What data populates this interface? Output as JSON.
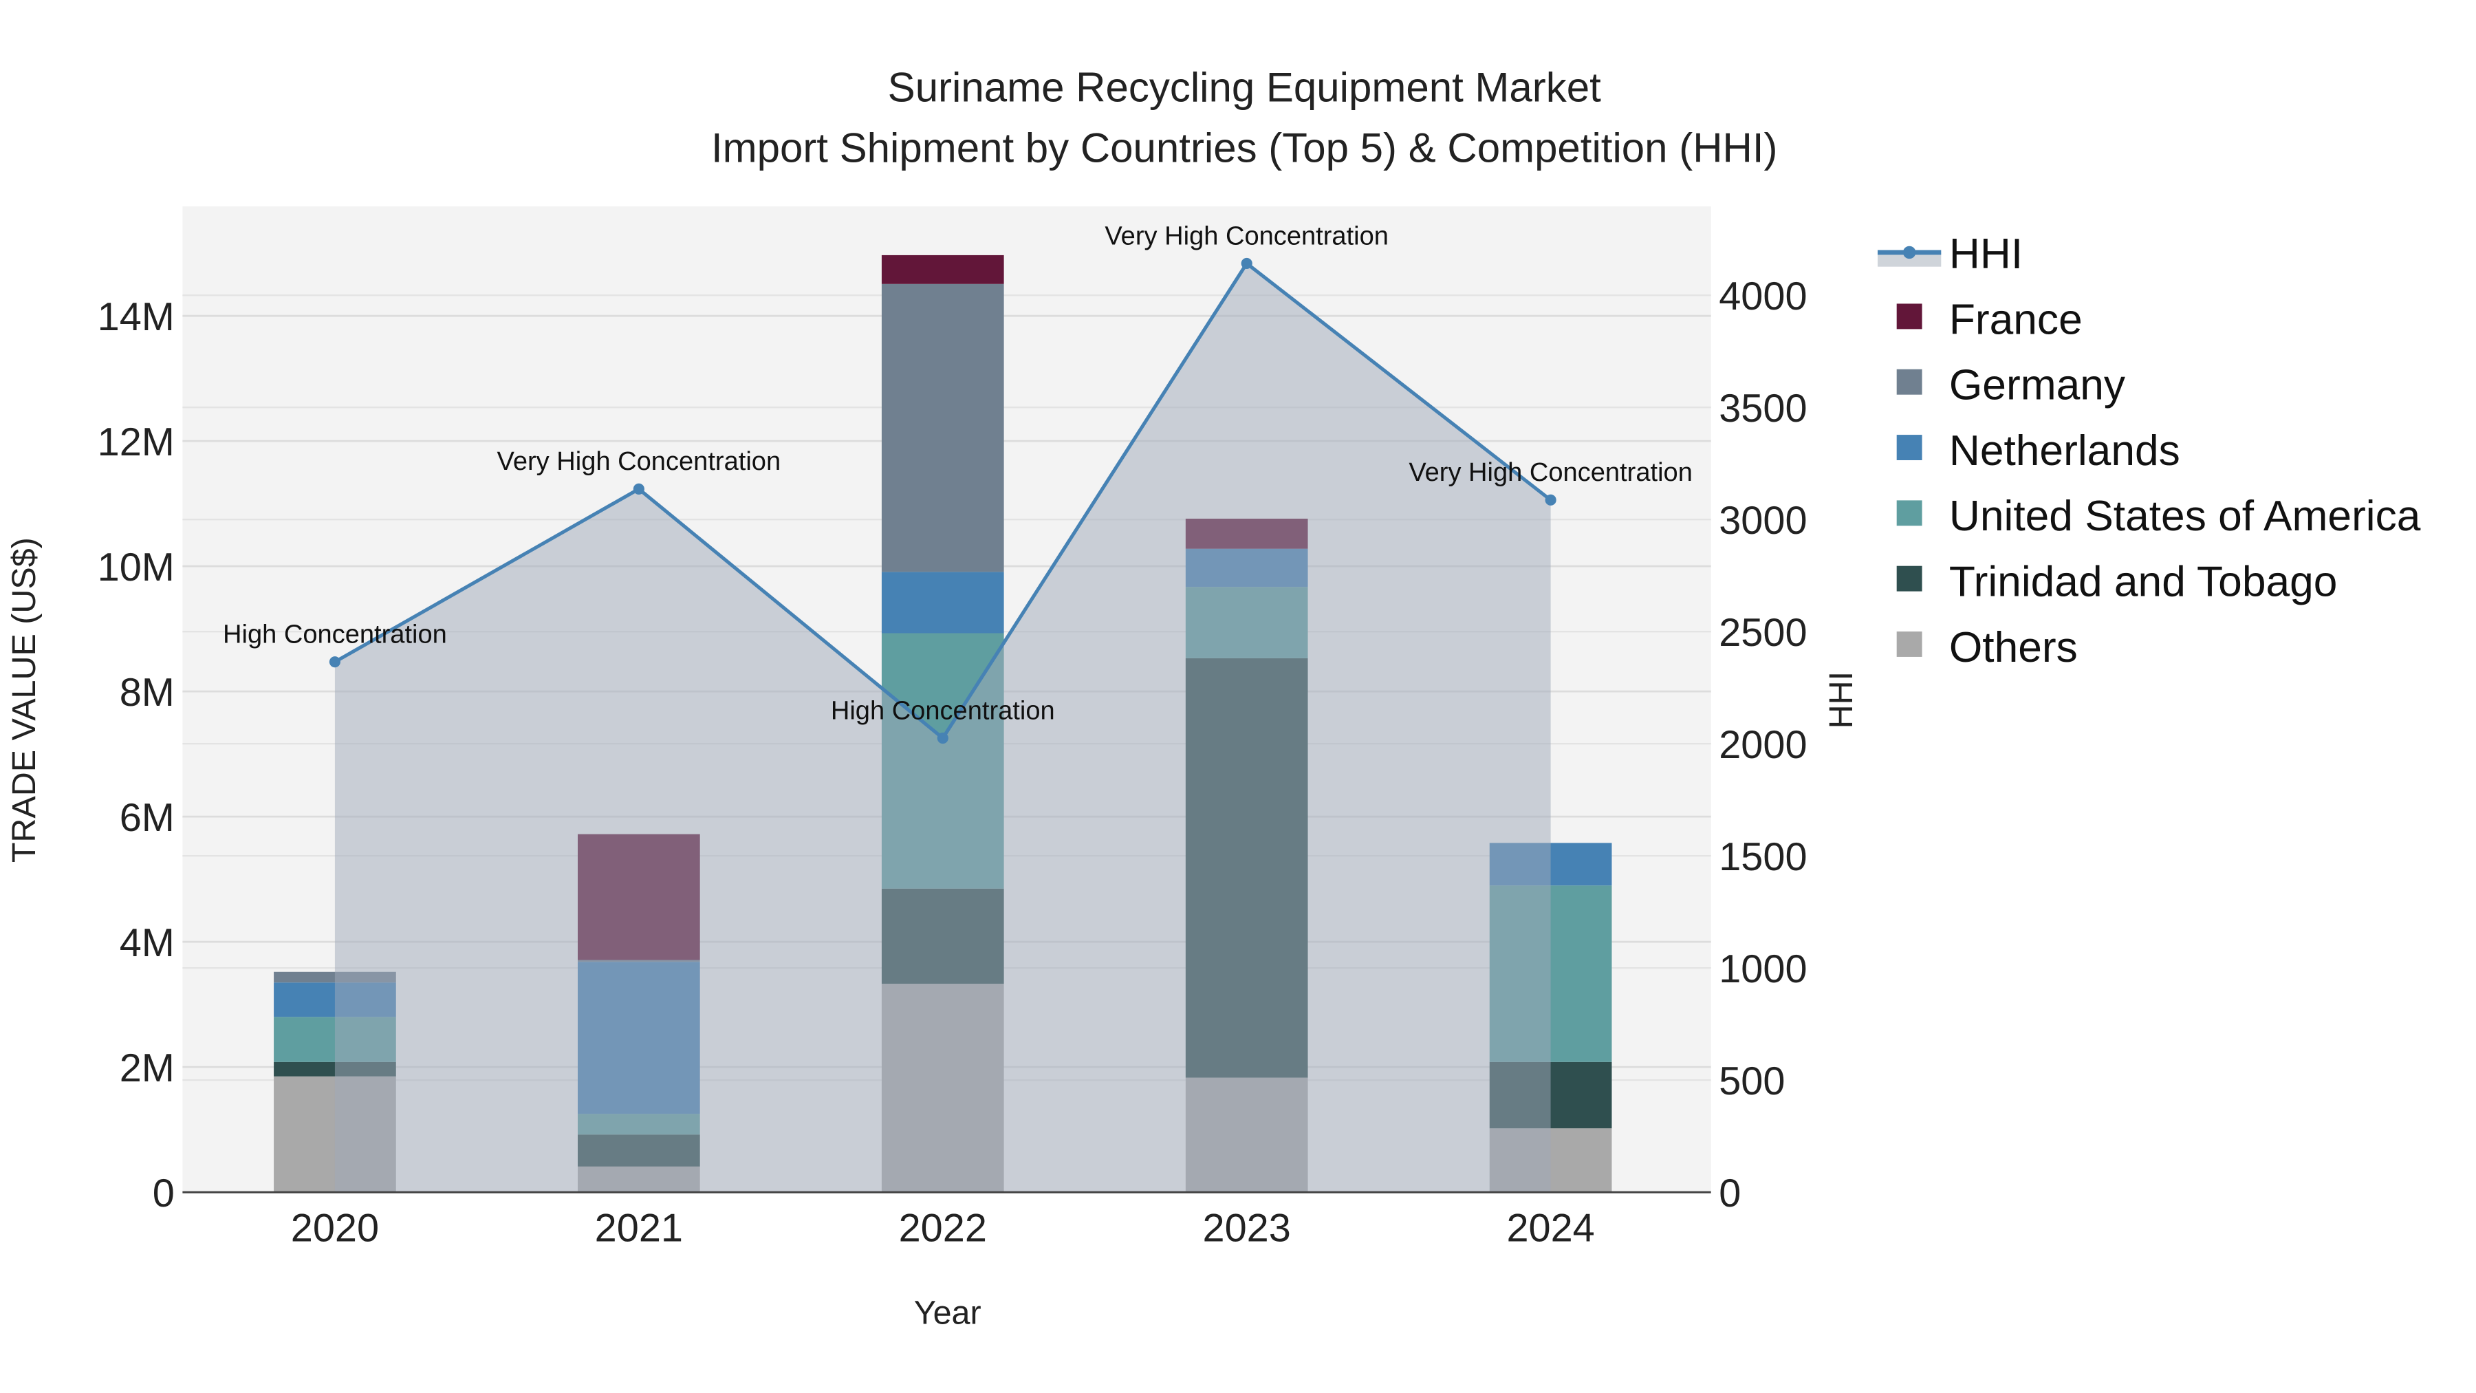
{
  "chart_data": {
    "type": "bar",
    "title": "Suriname Recycling Equipment Market",
    "subtitle": "Import Shipment by Countries (Top 5) & Competition (HHI)",
    "xlabel": "Year",
    "ylabel": "TRADE VALUE (US$)",
    "y2label": "HHI",
    "categories": [
      "2020",
      "2021",
      "2022",
      "2023",
      "2024"
    ],
    "ylim": [
      0,
      15.7
    ],
    "y_unit": "M",
    "y_ticks": [
      "0",
      "2M",
      "4M",
      "6M",
      "8M",
      "10M",
      "12M",
      "14M"
    ],
    "y_tick_values": [
      0,
      2,
      4,
      6,
      8,
      10,
      12,
      14
    ],
    "y2lim": [
      0,
      4400
    ],
    "y2_ticks": [
      "0",
      "500",
      "1000",
      "1500",
      "2000",
      "2500",
      "3000",
      "3500",
      "4000"
    ],
    "y2_tick_values": [
      0,
      500,
      1000,
      1500,
      2000,
      2500,
      3000,
      3500,
      4000
    ],
    "series": [
      {
        "name": "Others",
        "color": "#a9a9a9",
        "values": [
          1.85,
          0.41,
          3.33,
          1.83,
          1.02
        ]
      },
      {
        "name": "Trinidad and Tobago",
        "color": "#2f4f4f",
        "values": [
          0.23,
          0.51,
          1.52,
          6.7,
          1.06
        ]
      },
      {
        "name": "United States of America",
        "color": "#5f9ea0",
        "values": [
          0.72,
          0.33,
          4.08,
          1.14,
          2.82
        ]
      },
      {
        "name": "Netherlands",
        "color": "#4682b4",
        "values": [
          0.55,
          2.43,
          0.98,
          0.61,
          0.68
        ]
      },
      {
        "name": "Germany",
        "color": "#708090",
        "values": [
          0.17,
          0.03,
          4.6,
          0,
          0
        ]
      },
      {
        "name": "France",
        "color": "#621639",
        "values": [
          0,
          2.01,
          0.46,
          0.48,
          0
        ]
      }
    ],
    "line": {
      "name": "HHI",
      "color": "#4682b4",
      "values": [
        2365,
        3136,
        2025,
        4142,
        3087
      ],
      "annotations": [
        "High Concentration",
        "Very High Concentration",
        "High Concentration",
        "Very High Concentration",
        "Very High Concentration"
      ]
    },
    "legend_order": [
      "HHI",
      "France",
      "Germany",
      "Netherlands",
      "United States of America",
      "Trinidad and Tobago",
      "Others"
    ],
    "legend_placement": "right",
    "grid": true
  }
}
